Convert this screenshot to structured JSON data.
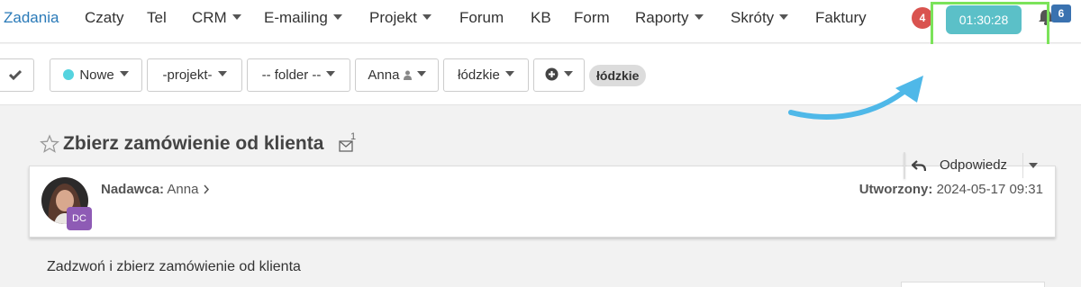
{
  "nav": {
    "items": [
      {
        "label": "Zadania",
        "active": true,
        "dropdown": false
      },
      {
        "label": "Czaty",
        "dropdown": false
      },
      {
        "label": "Tel",
        "dropdown": false
      },
      {
        "label": "CRM",
        "dropdown": true
      },
      {
        "label": "E-mailing",
        "dropdown": true
      },
      {
        "label": "Projekt",
        "dropdown": true
      },
      {
        "label": "Forum",
        "dropdown": false
      },
      {
        "label": "KB",
        "dropdown": false
      },
      {
        "label": "Form",
        "dropdown": false
      },
      {
        "label": "Raporty",
        "dropdown": true
      },
      {
        "label": "Skróty",
        "dropdown": true
      },
      {
        "label": "Faktury",
        "dropdown": false
      }
    ],
    "alert_count": "4",
    "timer": "01:30:28",
    "notification_count": "6"
  },
  "toolbar": {
    "status": "Nowe",
    "project": "-projekt-",
    "folder": "-- folder --",
    "user": "Anna",
    "region": "łódzkie",
    "tag": "łódzkie"
  },
  "task": {
    "title": "Zbierz zamówienie od klienta",
    "message_count": "1",
    "reply_label": "Odpowiedz",
    "sender_label": "Nadawca:",
    "sender_name": "Anna",
    "created_label": "Utworzony:",
    "created_value": "2024-05-17 09:31",
    "avatar_badge": "DC",
    "body": "Zadzwoń i zbierz zamówienie od klienta"
  },
  "colors": {
    "active_nav": "#2a7ab8",
    "timer_bg": "#5bc0c8",
    "highlight": "#7be35a",
    "arrow": "#4fb8e8",
    "alert_badge": "#d9534f",
    "notification_badge": "#3a72b0",
    "avatar_badge": "#8e5bb5"
  }
}
